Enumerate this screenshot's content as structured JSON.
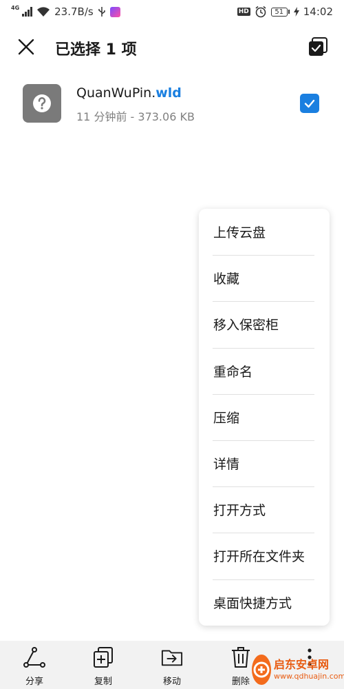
{
  "status_bar": {
    "network_type": "4G",
    "speed": "23.7B/s",
    "battery": "51",
    "time": "14:02"
  },
  "header": {
    "title": "已选择 1 项"
  },
  "file": {
    "name_base": "QuanWuPin.",
    "name_ext": "wld",
    "meta": "11 分钟前 - 373.06 KB",
    "checked": true
  },
  "menu": {
    "items": [
      "上传云盘",
      "收藏",
      "移入保密柜",
      "重命名",
      "压缩",
      "详情",
      "打开方式",
      "打开所在文件夹",
      "桌面快捷方式"
    ]
  },
  "toolbar": {
    "share_label": "分享",
    "copy_label": "复制",
    "move_label": "移动",
    "delete_label": "删除"
  },
  "watermark": {
    "title": "启东安卓网",
    "url": "www.qdhuajin.com"
  },
  "colors": {
    "accent": "#1a7fe0",
    "file_icon_bg": "#7a7a7a",
    "toolbar_bg": "#f2f2f2"
  }
}
